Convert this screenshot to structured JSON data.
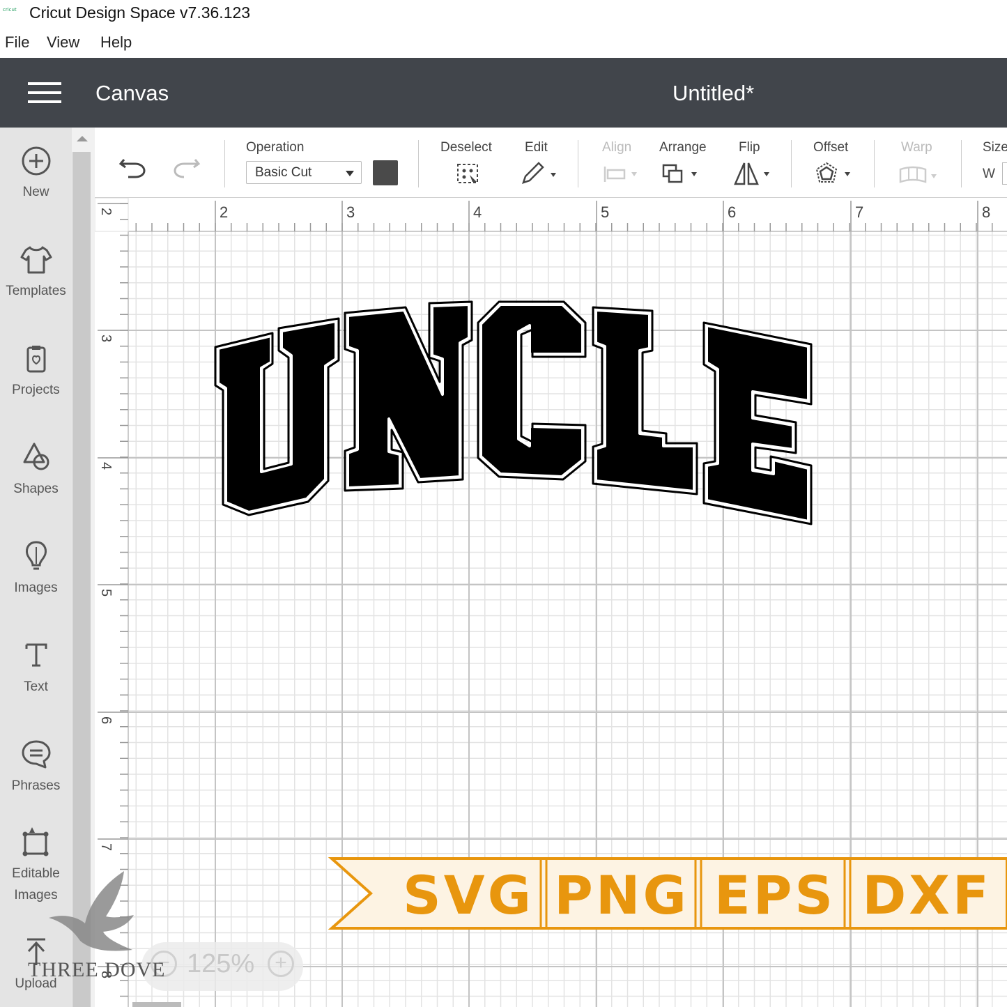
{
  "window": {
    "logo_text": "cricut",
    "title": "Cricut Design Space  v7.36.123"
  },
  "menu": {
    "items": [
      "File",
      "View",
      "Help"
    ]
  },
  "header": {
    "section": "Canvas",
    "document_title": "Untitled*"
  },
  "sidebar": {
    "items": [
      {
        "label": "New",
        "icon": "plus-circle-icon"
      },
      {
        "label": "Templates",
        "icon": "tshirt-icon"
      },
      {
        "label": "Projects",
        "icon": "projects-icon"
      },
      {
        "label": "Shapes",
        "icon": "shapes-icon"
      },
      {
        "label": "Images",
        "icon": "lightbulb-icon"
      },
      {
        "label": "Text",
        "icon": "text-t-icon"
      },
      {
        "label": "Phrases",
        "icon": "speech-bubble-icon"
      },
      {
        "label": "Editable Images",
        "icon": "editable-image-icon"
      },
      {
        "label": "Upload",
        "icon": "upload-icon"
      }
    ]
  },
  "toolbar": {
    "operation_label": "Operation",
    "operation_value": "Basic Cut",
    "deselect_label": "Deselect",
    "edit_label": "Edit",
    "align_label": "Align",
    "arrange_label": "Arrange",
    "flip_label": "Flip",
    "offset_label": "Offset",
    "warp_label": "Warp",
    "size_label": "Size",
    "size_w": "W",
    "swatch_color": "#4a4a4a"
  },
  "ruler": {
    "top_numbers": [
      "2",
      "3",
      "4",
      "5",
      "6",
      "7",
      "8"
    ],
    "left_numbers": [
      "2",
      "3",
      "4",
      "5",
      "6",
      "7",
      "8"
    ]
  },
  "design": {
    "text": "UNCLE",
    "fill": "#000000",
    "outline": "#ffffff"
  },
  "banner": {
    "formats": [
      "SVG",
      "PNG",
      "EPS",
      "DXF"
    ],
    "text_color": "#e8960e",
    "background": "#fdf3e3",
    "border_color": "#e8960e"
  },
  "zoom": {
    "value": "125%",
    "minus": "−",
    "plus": "+"
  },
  "watermark": {
    "text": "THREE DOVE"
  }
}
